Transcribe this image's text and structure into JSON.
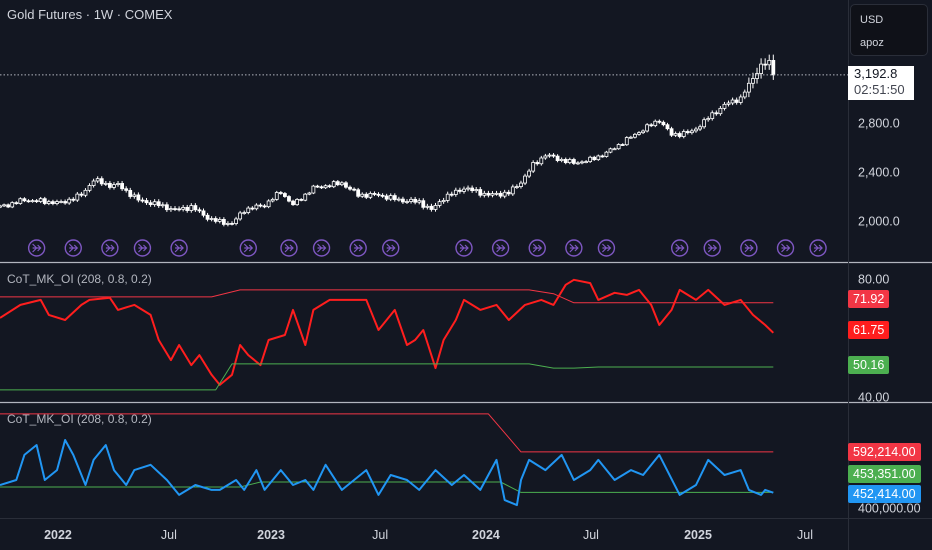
{
  "header": {
    "title": "Gold Futures · 1W · COMEX"
  },
  "currency_box": {
    "currency": "USD",
    "unit": "apoz"
  },
  "last_price": {
    "price": "3,192.8",
    "countdown": "02:51:50"
  },
  "colors": {
    "bg": "#131722",
    "candle": "#ffffff",
    "red": "#f23645",
    "red2": "#ff1e1e",
    "green": "#4caf50",
    "blue": "#2196f3",
    "event": "#7e57c2",
    "grid": "#2a2e39"
  },
  "chart_data": [
    {
      "type": "candlestick",
      "name": "Gold Futures",
      "title": "Gold Futures · 1W · COMEX",
      "x_unit": "week index",
      "ylim": [
        1665,
        3804
      ],
      "yticks": [
        {
          "v": 2000,
          "label": "2,000.0"
        },
        {
          "v": 2400,
          "label": "2,400.0"
        },
        {
          "v": 2800,
          "label": "2,800.0"
        }
      ],
      "close_anchors": [
        [
          0,
          2114
        ],
        [
          6,
          2171
        ],
        [
          15,
          2147
        ],
        [
          20,
          2212
        ],
        [
          23,
          2335
        ],
        [
          27,
          2290
        ],
        [
          29,
          2294
        ],
        [
          34,
          2171
        ],
        [
          39,
          2131
        ],
        [
          43,
          2090
        ],
        [
          47,
          2114
        ],
        [
          52,
          2008
        ],
        [
          57,
          1976
        ],
        [
          60,
          2090
        ],
        [
          65,
          2131
        ],
        [
          69,
          2237
        ],
        [
          72,
          2131
        ],
        [
          77,
          2269
        ],
        [
          84,
          2310
        ],
        [
          88,
          2212
        ],
        [
          93,
          2212
        ],
        [
          98,
          2171
        ],
        [
          103,
          2155
        ],
        [
          106,
          2090
        ],
        [
          109,
          2188
        ],
        [
          114,
          2269
        ],
        [
          120,
          2212
        ],
        [
          125,
          2229
        ],
        [
          128,
          2318
        ],
        [
          131,
          2457
        ],
        [
          134,
          2539
        ],
        [
          138,
          2498
        ],
        [
          141,
          2473
        ],
        [
          145,
          2498
        ],
        [
          149,
          2555
        ],
        [
          152,
          2620
        ],
        [
          157,
          2727
        ],
        [
          162,
          2824
        ],
        [
          165,
          2702
        ],
        [
          170,
          2727
        ],
        [
          174,
          2841
        ],
        [
          178,
          2947
        ],
        [
          182,
          3004
        ],
        [
          184,
          3110
        ],
        [
          187,
          3273
        ],
        [
          189,
          3290
        ],
        [
          190,
          3192.8
        ]
      ],
      "last_value": 3192.8,
      "event_weeks": [
        9,
        18,
        27,
        35,
        44,
        61,
        71,
        79,
        88,
        96,
        114,
        123,
        132,
        141,
        149,
        167,
        175,
        184,
        193,
        201
      ]
    },
    {
      "type": "line",
      "name": "CoT_MK_OI (208, 0.8, 0.2)",
      "label": "CoT_MK_OI (208, 0.8, 0.2)",
      "ylim": [
        38.3,
        85.4
      ],
      "yticks": [
        {
          "v": 80,
          "label": "80.00"
        },
        {
          "v": 40,
          "label": "40.00"
        }
      ],
      "series": [
        {
          "name": "upper",
          "color": "#f23645",
          "last": "71.92",
          "points": [
            [
              0,
              73.9
            ],
            [
              52,
              73.9
            ],
            [
              59,
              76.3
            ],
            [
              130,
              76.3
            ],
            [
              136,
              75
            ],
            [
              141,
              71.92
            ],
            [
              190,
              71.92
            ]
          ]
        },
        {
          "name": "index",
          "color": "#ff1e1e",
          "last": "61.75",
          "points": [
            [
              0,
              66.8
            ],
            [
              5,
              71.2
            ],
            [
              10,
              72.9
            ],
            [
              12,
              67.8
            ],
            [
              16,
              66.1
            ],
            [
              20,
              71.2
            ],
            [
              22,
              72.9
            ],
            [
              27,
              73.6
            ],
            [
              29,
              69.5
            ],
            [
              33,
              71.2
            ],
            [
              37,
              67.8
            ],
            [
              39,
              59.3
            ],
            [
              42,
              52.5
            ],
            [
              44,
              57.6
            ],
            [
              47,
              50.8
            ],
            [
              49,
              54.2
            ],
            [
              52,
              47.5
            ],
            [
              54,
              44.1
            ],
            [
              57,
              47.5
            ],
            [
              59,
              57.6
            ],
            [
              61,
              54.2
            ],
            [
              64,
              50.8
            ],
            [
              66,
              59.3
            ],
            [
              70,
              61.0
            ],
            [
              72,
              69.5
            ],
            [
              75,
              57.6
            ],
            [
              77,
              69.5
            ],
            [
              81,
              72.9
            ],
            [
              85,
              72.9
            ],
            [
              90,
              72.9
            ],
            [
              93,
              62.7
            ],
            [
              97,
              69.5
            ],
            [
              100,
              57.6
            ],
            [
              102,
              59.3
            ],
            [
              104,
              62.7
            ],
            [
              107,
              49.8
            ],
            [
              109,
              59.3
            ],
            [
              112,
              66.1
            ],
            [
              114,
              72.9
            ],
            [
              118,
              69.5
            ],
            [
              122,
              71.2
            ],
            [
              125,
              66.1
            ],
            [
              129,
              71.2
            ],
            [
              133,
              72.9
            ],
            [
              136,
              71.2
            ],
            [
              139,
              78.0
            ],
            [
              141,
              79.7
            ],
            [
              145,
              78.6
            ],
            [
              147,
              72.9
            ],
            [
              151,
              75.3
            ],
            [
              154,
              74.6
            ],
            [
              157,
              76.3
            ],
            [
              160,
              71.2
            ],
            [
              162,
              64.4
            ],
            [
              165,
              69.5
            ],
            [
              167,
              76.3
            ],
            [
              171,
              72.9
            ],
            [
              174,
              76.3
            ],
            [
              178,
              71.2
            ],
            [
              182,
              72.9
            ],
            [
              185,
              67.8
            ],
            [
              188,
              64.4
            ],
            [
              190,
              61.75
            ]
          ]
        },
        {
          "name": "lower",
          "color": "#4caf50",
          "last": "50.16",
          "points": [
            [
              0,
              42.4
            ],
            [
              53,
              42.4
            ],
            [
              57,
              51.2
            ],
            [
              130,
              51.2
            ],
            [
              136,
              49.8
            ],
            [
              141,
              49.8
            ],
            [
              147,
              50.16
            ],
            [
              190,
              50.16
            ]
          ]
        }
      ]
    },
    {
      "type": "line",
      "name": "CoT_MK_OI (208, 0.8, 0.2)",
      "label": "CoT_MK_OI (208, 0.8, 0.2)",
      "value_unit": "thousands",
      "ylim": [
        365.7,
        760
      ],
      "yticks": [
        {
          "v": 400,
          "label": "400,000.00"
        }
      ],
      "series": [
        {
          "name": "upper",
          "color": "#f23645",
          "last": "592,214.00",
          "points": [
            [
              0,
              722.6
            ],
            [
              120,
              722.6
            ],
            [
              128,
              592.2
            ],
            [
              190,
              592.2
            ]
          ]
        },
        {
          "name": "lower",
          "color": "#4caf50",
          "last": "453,351.00",
          "points": [
            [
              0,
              472
            ],
            [
              59,
              472
            ],
            [
              64,
              489
            ],
            [
              123,
              489
            ],
            [
              128,
              453.4
            ],
            [
              190,
              453.4
            ]
          ]
        },
        {
          "name": "open-interest",
          "color": "#2196f3",
          "last": "452,414.00",
          "points": [
            [
              0,
              479
            ],
            [
              4,
              496
            ],
            [
              6,
              582
            ],
            [
              9,
              616
            ],
            [
              11,
              496
            ],
            [
              14,
              530
            ],
            [
              16,
              633
            ],
            [
              18,
              582
            ],
            [
              21,
              479
            ],
            [
              23,
              565
            ],
            [
              26,
              616
            ],
            [
              28,
              530
            ],
            [
              31,
              479
            ],
            [
              33,
              530
            ],
            [
              37,
              548
            ],
            [
              41,
              496
            ],
            [
              44,
              445
            ],
            [
              48,
              479
            ],
            [
              52,
              462
            ],
            [
              54,
              462
            ],
            [
              58,
              496
            ],
            [
              60,
              462
            ],
            [
              63,
              530
            ],
            [
              65,
              462
            ],
            [
              69,
              530
            ],
            [
              72,
              479
            ],
            [
              75,
              496
            ],
            [
              77,
              462
            ],
            [
              80,
              548
            ],
            [
              84,
              462
            ],
            [
              87,
              496
            ],
            [
              90,
              530
            ],
            [
              93,
              445
            ],
            [
              96,
              513
            ],
            [
              100,
              496
            ],
            [
              103,
              462
            ],
            [
              107,
              530
            ],
            [
              111,
              479
            ],
            [
              114,
              513
            ],
            [
              118,
              462
            ],
            [
              122,
              565
            ],
            [
              124,
              427
            ],
            [
              127,
              410
            ],
            [
              128,
              496
            ],
            [
              130,
              565
            ],
            [
              134,
              530
            ],
            [
              138,
              582
            ],
            [
              141,
              496
            ],
            [
              145,
              530
            ],
            [
              147,
              565
            ],
            [
              151,
              496
            ],
            [
              155,
              530
            ],
            [
              158,
              513
            ],
            [
              162,
              582
            ],
            [
              167,
              445
            ],
            [
              171,
              479
            ],
            [
              174,
              565
            ],
            [
              178,
              513
            ],
            [
              182,
              530
            ],
            [
              184,
              462
            ],
            [
              187,
              445
            ],
            [
              188,
              462
            ],
            [
              190,
              452.4
            ]
          ]
        }
      ]
    }
  ],
  "time_axis": [
    {
      "w": 14.25,
      "label": "2022",
      "bold": true
    },
    {
      "w": 41.5,
      "label": "Jul"
    },
    {
      "w": 66.6,
      "label": "2023",
      "bold": true
    },
    {
      "w": 93.4,
      "label": "Jul"
    },
    {
      "w": 119.4,
      "label": "2024",
      "bold": true
    },
    {
      "w": 145.2,
      "label": "Jul"
    },
    {
      "w": 171.5,
      "label": "2025",
      "bold": true
    },
    {
      "w": 197.8,
      "label": "Jul"
    }
  ]
}
